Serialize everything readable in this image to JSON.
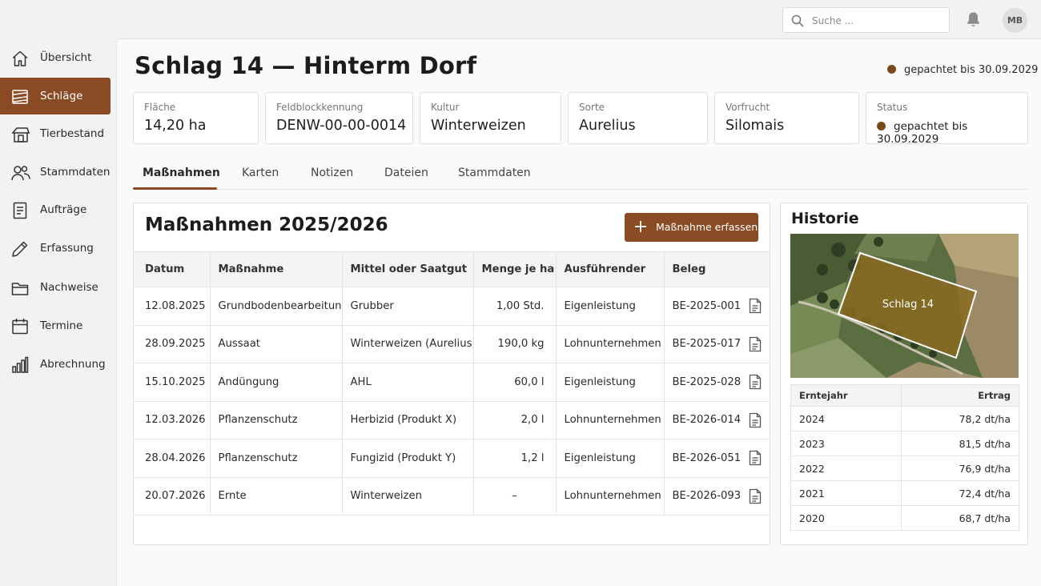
{
  "search": {
    "placeholder": "Suche ..."
  },
  "user": {
    "initials": "MB"
  },
  "sidebar": {
    "items": [
      {
        "label": "Übersicht",
        "icon": "home-icon"
      },
      {
        "label": "Schläge",
        "icon": "field-icon",
        "active": true
      },
      {
        "label": "Tierbestand",
        "icon": "barn-icon"
      },
      {
        "label": "Stammdaten",
        "icon": "users-icon"
      },
      {
        "label": "Aufträge",
        "icon": "document-icon"
      },
      {
        "label": "Erfassung",
        "icon": "pencil-icon"
      },
      {
        "label": "Nachweise",
        "icon": "folder-icon"
      },
      {
        "label": "Termine",
        "icon": "calendar-icon"
      },
      {
        "label": "Abrechnung",
        "icon": "bar-chart-icon"
      }
    ]
  },
  "header": {
    "title": "Schlag 14 — Hinterm Dorf",
    "status": "gepachtet bis 30.09.2029",
    "status_color": "#7a4a1e"
  },
  "cards": [
    {
      "key": "Fläche",
      "value": "14,20 ha"
    },
    {
      "key": "Feldblockkennung",
      "value": "DENW-00-00-0014"
    },
    {
      "key": "Kultur",
      "value": "Winterweizen"
    },
    {
      "key": "Sorte",
      "value": "Aurelius"
    },
    {
      "key": "Vorfrucht",
      "value": "Silomais"
    },
    {
      "key": "Status",
      "value": "gepachtet bis 30.09.2029"
    }
  ],
  "tabs": [
    "Maßnahmen",
    "Karten",
    "Notizen",
    "Dateien",
    "Stammdaten"
  ],
  "measures": {
    "title": "Maßnahmen 2025/2026",
    "add_label": "Maßnahme erfassen",
    "columns": [
      "Datum",
      "Maßnahme",
      "Mittel oder Saatgut",
      "Menge je ha",
      "Ausführender",
      "Beleg"
    ],
    "rows": [
      [
        "12.08.2025",
        "Grundbodenbearbeitung",
        "Grubber",
        "1,00 Std.",
        "Eigenleistung",
        "BE-2025-001"
      ],
      [
        "28.09.2025",
        "Aussaat",
        "Winterweizen (Aurelius)",
        "190,0 kg",
        "Lohnunternehmen",
        "BE-2025-017"
      ],
      [
        "15.10.2025",
        "Andüngung",
        "AHL",
        "60,0 l",
        "Eigenleistung",
        "BE-2025-028"
      ],
      [
        "12.03.2026",
        "Pflanzenschutz",
        "Herbizid (Produkt X)",
        "2,0 l",
        "Lohnunternehmen",
        "BE-2026-014"
      ],
      [
        "28.04.2026",
        "Pflanzenschutz",
        "Fungizid (Produkt Y)",
        "1,2 l",
        "Eigenleistung",
        "BE-2026-051"
      ],
      [
        "20.07.2026",
        "Ernte",
        "Winterweizen",
        "–",
        "Lohnunternehmen",
        "BE-2026-093"
      ]
    ]
  },
  "history": {
    "title": "Historie",
    "map_label": "Schlag 14",
    "columns": [
      "Erntejahr",
      "Ertrag"
    ],
    "rows": [
      [
        "2024",
        "78,2 dt/ha"
      ],
      [
        "2023",
        "81,5 dt/ha"
      ],
      [
        "2022",
        "76,9 dt/ha"
      ],
      [
        "2021",
        "72,4 dt/ha"
      ],
      [
        "2020",
        "68,7 dt/ha"
      ]
    ]
  },
  "colors": {
    "accent": "#8a4a24",
    "field_fill": "#8a6a20"
  }
}
